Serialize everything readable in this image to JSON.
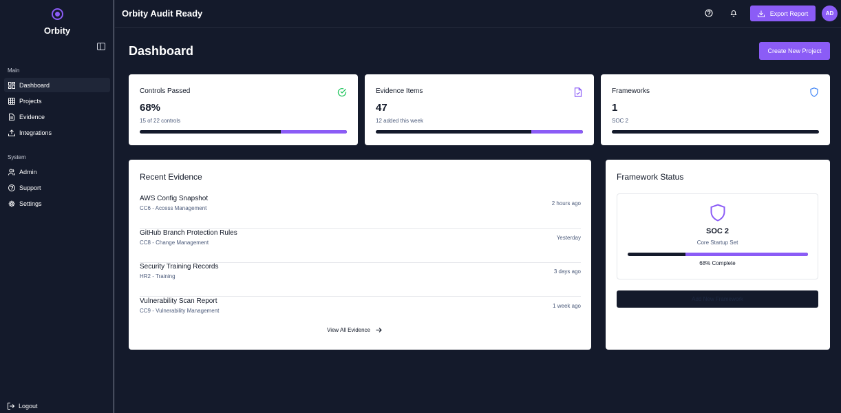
{
  "brand": {
    "name": "Orbity"
  },
  "sidebar": {
    "sections": [
      {
        "label": "Main",
        "items": [
          {
            "label": "Dashboard",
            "icon": "grid-icon",
            "active": true
          },
          {
            "label": "Projects",
            "icon": "table-icon"
          },
          {
            "label": "Evidence",
            "icon": "file-icon"
          },
          {
            "label": "Integrations",
            "icon": "upload-icon"
          }
        ]
      },
      {
        "label": "System",
        "items": [
          {
            "label": "Admin",
            "icon": "users-icon"
          },
          {
            "label": "Support",
            "icon": "help-icon"
          },
          {
            "label": "Settings",
            "icon": "gear-icon"
          }
        ]
      }
    ],
    "logout": "Logout"
  },
  "header": {
    "title": "Orbity Audit Ready",
    "export_label": "Export Report",
    "avatar_initials": "AD"
  },
  "main": {
    "title": "Dashboard",
    "create_label": "Create New Project",
    "stats": [
      {
        "title": "Controls Passed",
        "value": "68%",
        "sub": "15 of 22 controls",
        "progress": 0.32,
        "icon": "check-circle-icon",
        "icon_color": "#22c55e"
      },
      {
        "title": "Evidence Items",
        "value": "47",
        "sub": "12 added this week",
        "progress": 0.25,
        "icon": "file-check-icon",
        "icon_color": "#8b5cf6"
      },
      {
        "title": "Frameworks",
        "value": "1",
        "sub": "SOC 2",
        "progress": 0,
        "icon": "shield-icon",
        "icon_color": "#3b82f6"
      }
    ],
    "recent_evidence": {
      "title": "Recent Evidence",
      "items": [
        {
          "name": "AWS Config Snapshot",
          "control": "CC6 - Access Management",
          "time": "2 hours ago"
        },
        {
          "name": "GitHub Branch Protection Rules",
          "control": "CC8 - Change Management",
          "time": "Yesterday"
        },
        {
          "name": "Security Training Records",
          "control": "HR2 - Training",
          "time": "3 days ago"
        },
        {
          "name": "Vulnerability Scan Report",
          "control": "CC9 - Vulnerability Management",
          "time": "1 week ago"
        }
      ],
      "view_all": "View All Evidence"
    },
    "framework_status": {
      "title": "Framework Status",
      "framework": {
        "name": "SOC 2",
        "sub": "Core Startup Set",
        "progress": 0.68,
        "complete_label": "68% Complete"
      },
      "add_label": "Add New Framework"
    }
  },
  "colors": {
    "accent": "#8b5cf6",
    "background": "#141a2b",
    "card": "#ffffff"
  }
}
